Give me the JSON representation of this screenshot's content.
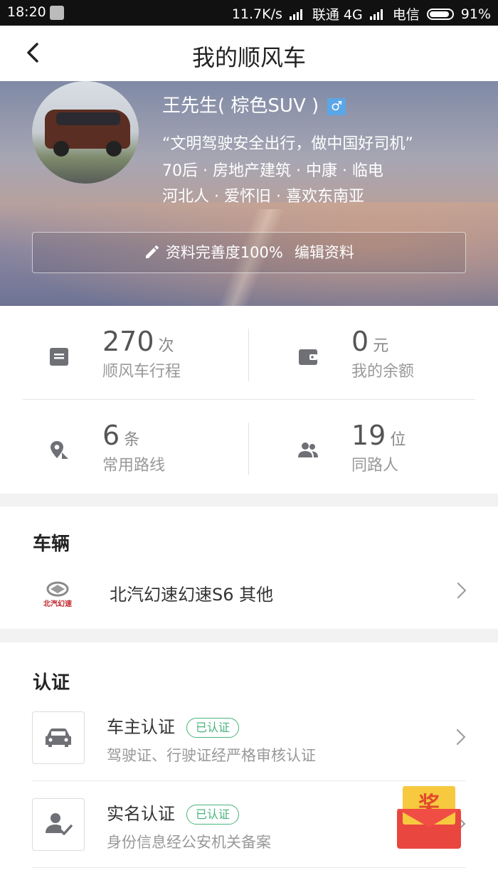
{
  "status_bar": {
    "time": "18:20",
    "network_speed": "11.7K/s",
    "carrier1": "联通 4G",
    "carrier2": "电信",
    "battery": "91%"
  },
  "header": {
    "title": "我的顺风车",
    "back_icon": "chevron-left-icon"
  },
  "profile": {
    "name": "王先生( 棕色SUV )",
    "gender_symbol": "♂",
    "motto": "“文明驾驶安全出行，做中国好司机”",
    "tags_line1": "70后 · 房地产建筑 · 中康 · 临电",
    "tags_line2": "河北人 · 爱怀旧 · 喜欢东南亚",
    "completion_text": "资料完善度100%",
    "edit_label": "编辑资料"
  },
  "stats": [
    {
      "value": "270",
      "unit": "次",
      "label": "顺风车行程",
      "icon": "calendar-icon"
    },
    {
      "value": "0",
      "unit": "元",
      "label": "我的余额",
      "icon": "wallet-icon"
    },
    {
      "value": "6",
      "unit": "条",
      "label": "常用路线",
      "icon": "route-pin-icon"
    },
    {
      "value": "19",
      "unit": "位",
      "label": "同路人",
      "icon": "people-icon"
    }
  ],
  "vehicle": {
    "section_title": "车辆",
    "brand_text": "北汽幻速",
    "name": "北汽幻速幻速S6 其他"
  },
  "certification": {
    "section_title": "认证",
    "items": [
      {
        "title": "车主认证",
        "badge": "已认证",
        "desc": "驾驶证、行驶证经严格审核认证",
        "icon": "car-icon"
      },
      {
        "title": "实名认证",
        "badge": "已认证",
        "desc": "身份信息经公安机关备案",
        "icon": "user-check-icon"
      }
    ]
  },
  "reward": {
    "label": "奖"
  },
  "colors": {
    "accent_green": "#48b47c",
    "reward_red": "#e9463f",
    "reward_yellow": "#f6c93f"
  }
}
